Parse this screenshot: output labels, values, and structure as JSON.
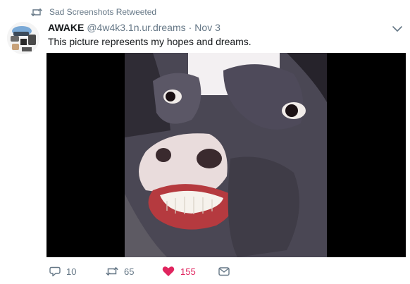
{
  "retweet": {
    "label": "Sad Screenshots Retweeted",
    "icon": "retweet-icon"
  },
  "tweet": {
    "name": "AWAKE",
    "handle": "@4w4k3.1n.ur.dreams",
    "separator": "·",
    "time": "Nov 3",
    "text": "This picture represents my hopes and dreams."
  },
  "actions": {
    "replies": "10",
    "retweets": "65",
    "likes": "155"
  },
  "colors": {
    "secondary": "#657786",
    "like": "#e0245e",
    "media_background": "#000000"
  }
}
